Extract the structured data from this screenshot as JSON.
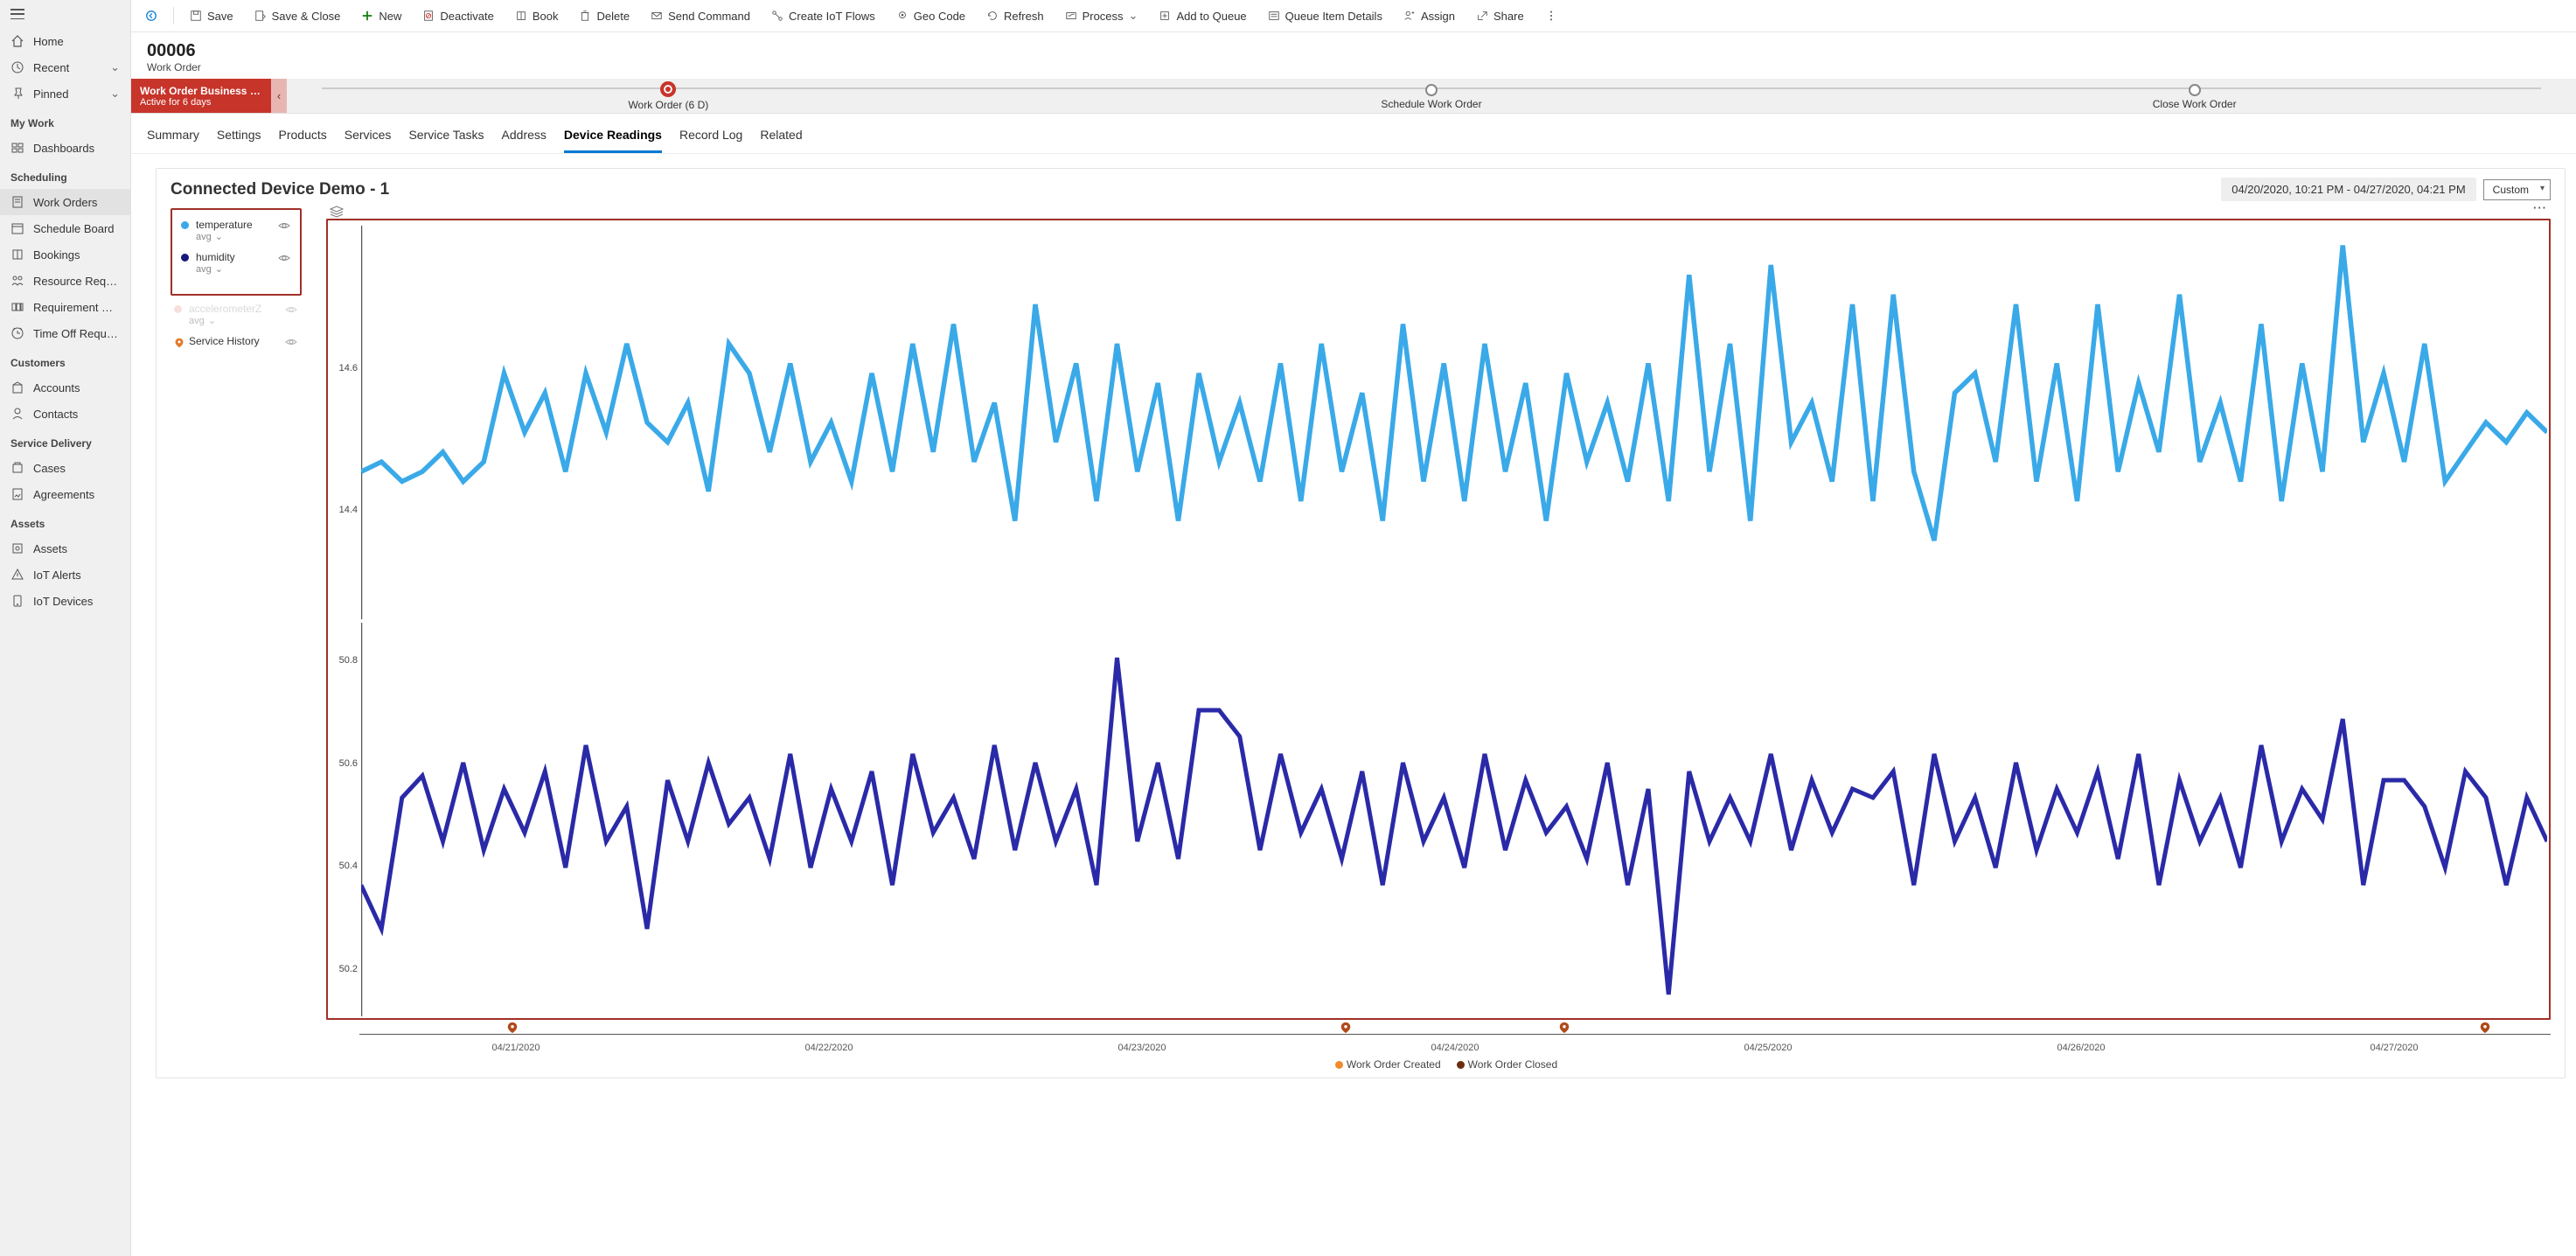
{
  "sidebar": {
    "top": [
      {
        "icon": "home",
        "label": "Home"
      },
      {
        "icon": "clock",
        "label": "Recent",
        "chev": true
      },
      {
        "icon": "pin",
        "label": "Pinned",
        "chev": true
      }
    ],
    "groups": [
      {
        "title": "My Work",
        "items": [
          {
            "icon": "dash",
            "label": "Dashboards"
          }
        ]
      },
      {
        "title": "Scheduling",
        "items": [
          {
            "icon": "doc",
            "label": "Work Orders",
            "active": true
          },
          {
            "icon": "cal",
            "label": "Schedule Board"
          },
          {
            "icon": "book",
            "label": "Bookings"
          },
          {
            "icon": "req",
            "label": "Resource Requireme..."
          },
          {
            "icon": "grp",
            "label": "Requirement Groups"
          },
          {
            "icon": "time",
            "label": "Time Off Requests"
          }
        ]
      },
      {
        "title": "Customers",
        "items": [
          {
            "icon": "acct",
            "label": "Accounts"
          },
          {
            "icon": "person",
            "label": "Contacts"
          }
        ]
      },
      {
        "title": "Service Delivery",
        "items": [
          {
            "icon": "case",
            "label": "Cases"
          },
          {
            "icon": "agr",
            "label": "Agreements"
          }
        ]
      },
      {
        "title": "Assets",
        "items": [
          {
            "icon": "asset",
            "label": "Assets"
          },
          {
            "icon": "alert",
            "label": "IoT Alerts"
          },
          {
            "icon": "device",
            "label": "IoT Devices"
          }
        ]
      }
    ]
  },
  "commandbar": [
    {
      "icon": "back",
      "label": "",
      "iconOnly": true,
      "color": "#0078d4"
    },
    {
      "sep": true
    },
    {
      "icon": "save",
      "label": "Save"
    },
    {
      "icon": "saveclose",
      "label": "Save & Close"
    },
    {
      "icon": "new",
      "label": "New",
      "color": "#107c10"
    },
    {
      "icon": "deact",
      "label": "Deactivate"
    },
    {
      "icon": "book",
      "label": "Book"
    },
    {
      "icon": "delete",
      "label": "Delete"
    },
    {
      "icon": "send",
      "label": "Send Command"
    },
    {
      "icon": "flow",
      "label": "Create IoT Flows"
    },
    {
      "icon": "geo",
      "label": "Geo Code"
    },
    {
      "icon": "refresh",
      "label": "Refresh"
    },
    {
      "icon": "process",
      "label": "Process",
      "chev": true
    },
    {
      "icon": "queue",
      "label": "Add to Queue"
    },
    {
      "icon": "qdetails",
      "label": "Queue Item Details"
    },
    {
      "icon": "assign",
      "label": "Assign"
    },
    {
      "icon": "share",
      "label": "Share"
    },
    {
      "icon": "more",
      "label": "",
      "iconOnly": true
    }
  ],
  "record": {
    "title": "00006",
    "subtitle": "Work Order"
  },
  "bpf": {
    "name": "Work Order Business Pro...",
    "status": "Active for 6 days",
    "stages": [
      {
        "label": "Work Order  (6 D)",
        "active": true
      },
      {
        "label": "Schedule Work Order"
      },
      {
        "label": "Close Work Order"
      }
    ]
  },
  "tabs": [
    "Summary",
    "Settings",
    "Products",
    "Services",
    "Service Tasks",
    "Address",
    "Device Readings",
    "Record Log",
    "Related"
  ],
  "activeTab": "Device Readings",
  "chart": {
    "title": "Connected Device Demo - 1",
    "range": "04/20/2020, 10:21 PM - 04/27/2020, 04:21 PM",
    "preset": "Custom",
    "legend": [
      {
        "color": "#3aa9e8",
        "name": "temperature",
        "sub": "avg"
      },
      {
        "color": "#18197a",
        "name": "humidity",
        "sub": "avg"
      }
    ],
    "legendExtra": [
      {
        "color": "#f3c6c2",
        "name": "accelerometerZ",
        "sub": "avg",
        "disabled": true
      },
      {
        "iconPin": true,
        "name": "Service History",
        "sh": true
      }
    ],
    "xticks": [
      "04/21/2020",
      "04/22/2020",
      "04/23/2020",
      "04/24/2020",
      "04/25/2020",
      "04/26/2020",
      "04/27/2020"
    ],
    "markers": [
      7,
      45,
      55,
      97
    ],
    "bottomLegend": [
      {
        "color": "#f28a2d",
        "label": "Work Order Created"
      },
      {
        "color": "#6b2d12",
        "label": "Work Order Closed"
      }
    ]
  },
  "chart_data": [
    {
      "type": "line",
      "title": "temperature",
      "ylabel": "",
      "yticks": [
        14.4,
        14.6
      ],
      "ylim": [
        14.3,
        14.7
      ],
      "x_range": [
        "04/20/2020 22:21",
        "04/27/2020 16:21"
      ],
      "series": [
        {
          "name": "temperature (avg)",
          "color": "#3aa9e8",
          "values": [
            14.45,
            14.46,
            14.44,
            14.45,
            14.47,
            14.44,
            14.46,
            14.55,
            14.49,
            14.53,
            14.45,
            14.55,
            14.49,
            14.58,
            14.5,
            14.48,
            14.52,
            14.43,
            14.58,
            14.55,
            14.47,
            14.56,
            14.46,
            14.5,
            14.44,
            14.55,
            14.45,
            14.58,
            14.47,
            14.6,
            14.46,
            14.52,
            14.4,
            14.62,
            14.48,
            14.56,
            14.42,
            14.58,
            14.45,
            14.54,
            14.4,
            14.55,
            14.46,
            14.52,
            14.44,
            14.56,
            14.42,
            14.58,
            14.45,
            14.53,
            14.4,
            14.6,
            14.44,
            14.56,
            14.42,
            14.58,
            14.45,
            14.54,
            14.4,
            14.55,
            14.46,
            14.52,
            14.44,
            14.56,
            14.42,
            14.65,
            14.45,
            14.58,
            14.4,
            14.66,
            14.48,
            14.52,
            14.44,
            14.62,
            14.42,
            14.63,
            14.45,
            14.38,
            14.53,
            14.55,
            14.46,
            14.62,
            14.44,
            14.56,
            14.42,
            14.62,
            14.45,
            14.54,
            14.47,
            14.63,
            14.46,
            14.52,
            14.44,
            14.6,
            14.42,
            14.56,
            14.45,
            14.68,
            14.48,
            14.55,
            14.46,
            14.58,
            14.44,
            14.47,
            14.5,
            14.48,
            14.51,
            14.49
          ]
        }
      ]
    },
    {
      "type": "line",
      "title": "humidity",
      "ylabel": "",
      "yticks": [
        50.2,
        50.4,
        50.6,
        50.8
      ],
      "ylim": [
        50.0,
        50.9
      ],
      "x_range": [
        "04/20/2020 22:21",
        "04/27/2020 16:21"
      ],
      "series": [
        {
          "name": "humidity (avg)",
          "color": "#2a2aa8",
          "values": [
            50.3,
            50.2,
            50.5,
            50.55,
            50.4,
            50.58,
            50.38,
            50.52,
            50.42,
            50.56,
            50.34,
            50.62,
            50.4,
            50.48,
            50.2,
            50.54,
            50.4,
            50.58,
            50.44,
            50.5,
            50.36,
            50.6,
            50.34,
            50.52,
            50.4,
            50.56,
            50.3,
            50.6,
            50.42,
            50.5,
            50.36,
            50.62,
            50.38,
            50.58,
            50.4,
            50.52,
            50.3,
            50.82,
            50.4,
            50.58,
            50.36,
            50.7,
            50.7,
            50.64,
            50.38,
            50.6,
            50.42,
            50.52,
            50.36,
            50.56,
            50.3,
            50.58,
            50.4,
            50.5,
            50.34,
            50.6,
            50.38,
            50.54,
            50.42,
            50.48,
            50.36,
            50.58,
            50.3,
            50.52,
            50.05,
            50.56,
            50.4,
            50.5,
            50.4,
            50.6,
            50.38,
            50.54,
            50.42,
            50.52,
            50.5,
            50.56,
            50.3,
            50.6,
            50.4,
            50.5,
            50.34,
            50.58,
            50.38,
            50.52,
            50.42,
            50.56,
            50.36,
            50.6,
            50.3,
            50.54,
            50.4,
            50.5,
            50.34,
            50.62,
            50.4,
            50.52,
            50.45,
            50.68,
            50.3,
            50.54,
            50.54,
            50.48,
            50.34,
            50.56,
            50.5,
            50.3,
            50.5,
            50.4
          ]
        }
      ]
    }
  ]
}
